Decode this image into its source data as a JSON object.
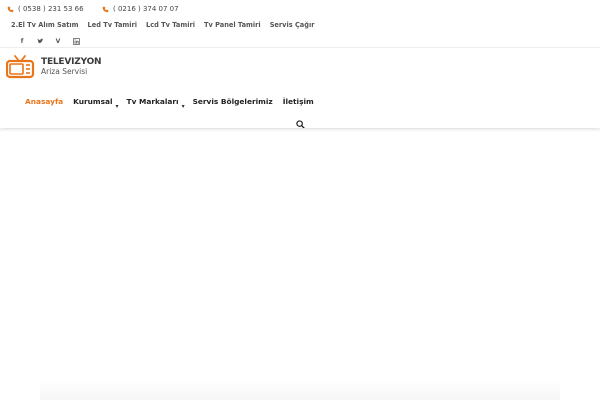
{
  "topbar": {
    "phone1": "( 0538 ) 231 53 66",
    "phone2": "( 0216 ) 374 07 07",
    "links": [
      "2.El Tv Alım Satım",
      "Led Tv Tamiri",
      "Lcd Tv Tamiri",
      "Tv Panel Tamiri",
      "Servis Çağır"
    ],
    "socials": [
      "facebook-icon",
      "twitter-icon",
      "vimeo-icon",
      "linkedin-icon"
    ]
  },
  "logo": {
    "title": "TELEVIZYON",
    "subtitle": "Ariza Servisi"
  },
  "nav": {
    "items": [
      "Anasayfa",
      "Kurumsal",
      "Tv Markaları",
      "Servis Bölgelerimiz",
      "İletişim"
    ]
  },
  "colors": {
    "accent": "#e8751a",
    "text": "#222222"
  }
}
